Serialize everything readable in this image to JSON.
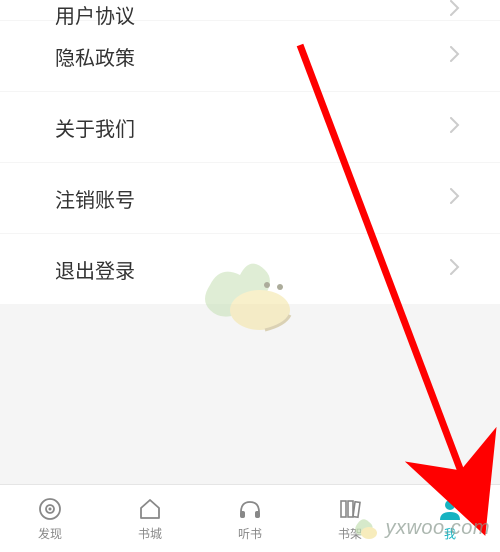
{
  "settings": {
    "items": [
      {
        "label": "用户协议"
      },
      {
        "label": "隐私政策"
      },
      {
        "label": "关于我们"
      },
      {
        "label": "注销账号"
      },
      {
        "label": "退出登录"
      }
    ]
  },
  "tabbar": {
    "tabs": [
      {
        "label": "发现"
      },
      {
        "label": "书城"
      },
      {
        "label": "听书"
      },
      {
        "label": "书架"
      },
      {
        "label": "我"
      }
    ],
    "active_index": 4
  },
  "watermark": {
    "text": "yxwoo.com"
  },
  "colors": {
    "accent": "#17b3c1",
    "arrow": "#ff0000"
  }
}
